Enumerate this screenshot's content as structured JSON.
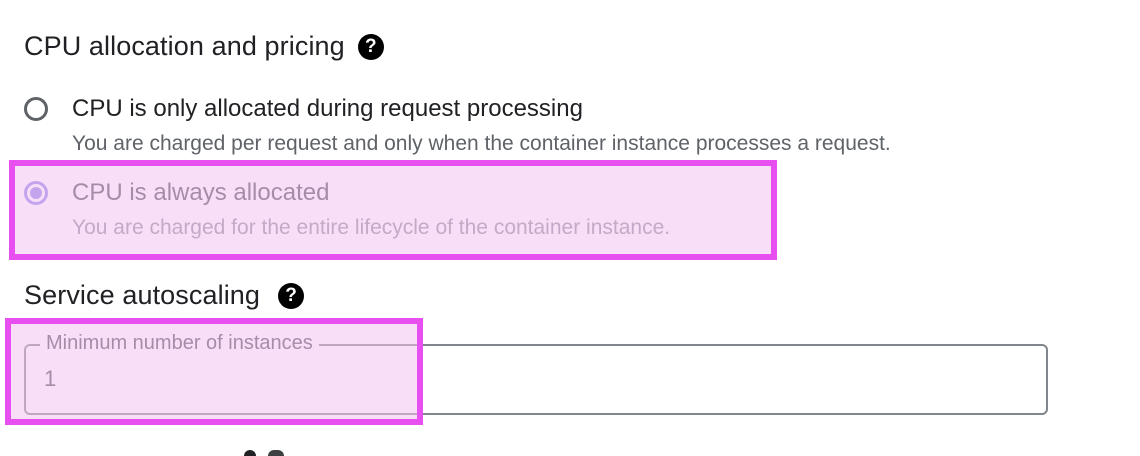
{
  "cpu_section": {
    "title": "CPU allocation and pricing",
    "help_icon": "help-circle-icon",
    "options": [
      {
        "label": "CPU is only allocated during request processing",
        "description": "You are charged per request and only when the container instance processes a request.",
        "selected": false
      },
      {
        "label": "CPU is always allocated",
        "description": "You are charged for the entire lifecycle of the container instance.",
        "selected": true
      }
    ]
  },
  "autoscaling_section": {
    "title": "Service autoscaling",
    "help_icon": "help-circle-icon",
    "min_instances": {
      "label": "Minimum number of instances",
      "value": "1"
    }
  },
  "colors": {
    "highlight_border": "#e84ff0",
    "highlight_fill": "#f4c2f0",
    "radio_accent": "#8a7fe6"
  }
}
